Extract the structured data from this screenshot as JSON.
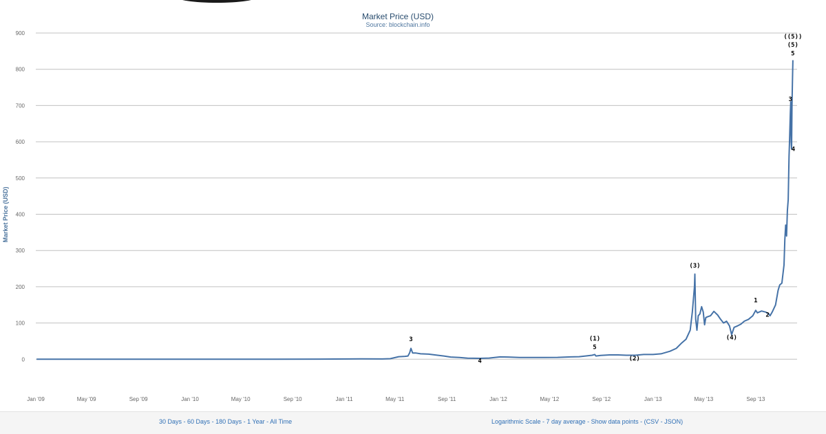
{
  "chart_data": {
    "type": "line",
    "title": "Market Price (USD)",
    "subtitle": "Source: blockchain.info",
    "ylabel": "Market Price (USD)",
    "xlabel": "",
    "xlim": [
      "2009-01-01",
      "2013-12-08"
    ],
    "ylim": [
      -100,
      900
    ],
    "yticks": [
      0,
      100,
      200,
      300,
      400,
      500,
      600,
      700,
      800,
      900
    ],
    "xticks": [
      {
        "date": "2009-01-01",
        "label": "Jan '09"
      },
      {
        "date": "2009-05-01",
        "label": "May '09"
      },
      {
        "date": "2009-09-01",
        "label": "Sep '09"
      },
      {
        "date": "2010-01-01",
        "label": "Jan '10"
      },
      {
        "date": "2010-05-01",
        "label": "May '10"
      },
      {
        "date": "2010-09-01",
        "label": "Sep '10"
      },
      {
        "date": "2011-01-01",
        "label": "Jan '11"
      },
      {
        "date": "2011-05-01",
        "label": "May '11"
      },
      {
        "date": "2011-09-01",
        "label": "Sep '11"
      },
      {
        "date": "2012-01-01",
        "label": "Jan '12"
      },
      {
        "date": "2012-05-01",
        "label": "May '12"
      },
      {
        "date": "2012-09-01",
        "label": "Sep '12"
      },
      {
        "date": "2013-01-01",
        "label": "Jan '13"
      },
      {
        "date": "2013-05-01",
        "label": "May '13"
      },
      {
        "date": "2013-09-01",
        "label": "Sep '13"
      }
    ],
    "grid": true,
    "line_color": "#4572a7",
    "series": [
      {
        "points": [
          [
            "2009-01-03",
            0
          ],
          [
            "2010-07-17",
            0.05
          ],
          [
            "2010-11-06",
            0.4
          ],
          [
            "2011-02-10",
            1
          ],
          [
            "2011-04-01",
            0.8
          ],
          [
            "2011-04-20",
            1.5
          ],
          [
            "2011-05-10",
            7
          ],
          [
            "2011-05-25",
            8
          ],
          [
            "2011-06-01",
            9
          ],
          [
            "2011-06-05",
            18
          ],
          [
            "2011-06-08",
            30
          ],
          [
            "2011-06-12",
            17
          ],
          [
            "2011-06-20",
            17
          ],
          [
            "2011-07-01",
            15
          ],
          [
            "2011-07-20",
            14
          ],
          [
            "2011-08-10",
            11
          ],
          [
            "2011-08-25",
            9
          ],
          [
            "2011-09-10",
            6
          ],
          [
            "2011-10-01",
            5
          ],
          [
            "2011-10-20",
            3
          ],
          [
            "2011-11-18",
            2.5
          ],
          [
            "2011-12-10",
            3.2
          ],
          [
            "2012-01-05",
            6.5
          ],
          [
            "2012-01-25",
            6
          ],
          [
            "2012-02-20",
            5
          ],
          [
            "2012-03-20",
            5
          ],
          [
            "2012-04-20",
            5
          ],
          [
            "2012-05-20",
            5.2
          ],
          [
            "2012-06-20",
            6.5
          ],
          [
            "2012-07-10",
            7
          ],
          [
            "2012-07-25",
            9
          ],
          [
            "2012-08-10",
            11
          ],
          [
            "2012-08-16",
            13
          ],
          [
            "2012-08-19",
            9
          ],
          [
            "2012-08-30",
            10.5
          ],
          [
            "2012-09-20",
            12
          ],
          [
            "2012-10-10",
            12
          ],
          [
            "2012-10-30",
            11
          ],
          [
            "2012-11-20",
            11
          ],
          [
            "2012-12-10",
            13
          ],
          [
            "2013-01-01",
            13
          ],
          [
            "2013-01-20",
            15
          ],
          [
            "2013-02-10",
            22
          ],
          [
            "2013-02-25",
            30
          ],
          [
            "2013-03-10",
            45
          ],
          [
            "2013-03-20",
            55
          ],
          [
            "2013-03-30",
            80
          ],
          [
            "2013-04-04",
            130
          ],
          [
            "2013-04-09",
            200
          ],
          [
            "2013-04-10",
            235
          ],
          [
            "2013-04-12",
            110
          ],
          [
            "2013-04-15",
            80
          ],
          [
            "2013-04-18",
            120
          ],
          [
            "2013-04-22",
            125
          ],
          [
            "2013-04-26",
            145
          ],
          [
            "2013-04-30",
            130
          ],
          [
            "2013-05-03",
            95
          ],
          [
            "2013-05-06",
            115
          ],
          [
            "2013-05-10",
            117
          ],
          [
            "2013-05-17",
            120
          ],
          [
            "2013-05-25",
            132
          ],
          [
            "2013-06-03",
            122
          ],
          [
            "2013-06-10",
            110
          ],
          [
            "2013-06-17",
            100
          ],
          [
            "2013-06-24",
            105
          ],
          [
            "2013-07-01",
            92
          ],
          [
            "2013-07-06",
            68
          ],
          [
            "2013-07-12",
            88
          ],
          [
            "2013-07-20",
            92
          ],
          [
            "2013-07-28",
            97
          ],
          [
            "2013-08-05",
            105
          ],
          [
            "2013-08-15",
            110
          ],
          [
            "2013-08-25",
            120
          ],
          [
            "2013-09-01",
            135
          ],
          [
            "2013-09-05",
            128
          ],
          [
            "2013-09-15",
            133
          ],
          [
            "2013-09-25",
            130
          ],
          [
            "2013-10-02",
            125
          ],
          [
            "2013-10-05",
            120
          ],
          [
            "2013-10-10",
            130
          ],
          [
            "2013-10-18",
            150
          ],
          [
            "2013-10-24",
            190
          ],
          [
            "2013-10-28",
            205
          ],
          [
            "2013-11-02",
            210
          ],
          [
            "2013-11-07",
            260
          ],
          [
            "2013-11-09",
            330
          ],
          [
            "2013-11-11",
            370
          ],
          [
            "2013-11-13",
            340
          ],
          [
            "2013-11-15",
            410
          ],
          [
            "2013-11-17",
            440
          ],
          [
            "2013-11-18",
            500
          ],
          [
            "2013-11-19",
            560
          ],
          [
            "2013-11-20",
            600
          ],
          [
            "2013-11-22",
            680
          ],
          [
            "2013-11-23",
            710
          ],
          [
            "2013-11-24",
            600
          ],
          [
            "2013-11-25",
            580
          ],
          [
            "2013-11-26",
            700
          ],
          [
            "2013-11-27",
            760
          ],
          [
            "2013-11-28",
            825
          ]
        ]
      }
    ],
    "annotations": [
      {
        "text": "3",
        "date": "2011-06-08",
        "value": 50
      },
      {
        "text": "4",
        "date": "2011-11-18",
        "value": -10
      },
      {
        "text": "(1)",
        "date": "2012-08-16",
        "value": 52
      },
      {
        "text": "5",
        "date": "2012-08-16",
        "value": 28
      },
      {
        "text": "(2)",
        "date": "2012-11-18",
        "value": -3
      },
      {
        "text": "(3)",
        "date": "2013-04-10",
        "value": 253
      },
      {
        "text": "(4)",
        "date": "2013-07-06",
        "value": 55
      },
      {
        "text": "1",
        "date": "2013-09-01",
        "value": 157
      },
      {
        "text": "2",
        "date": "2013-09-29",
        "value": 117
      },
      {
        "text": "3",
        "date": "2013-11-22",
        "value": 712
      },
      {
        "text": "4",
        "date": "2013-11-29",
        "value": 575
      },
      {
        "text": "5",
        "date": "2013-11-28",
        "value": 838
      },
      {
        "text": "(5)",
        "date": "2013-11-28",
        "value": 862
      },
      {
        "text": "((5))",
        "date": "2013-11-28",
        "value": 885
      }
    ]
  },
  "footer": {
    "range_links": [
      "30 Days",
      "60 Days",
      "180 Days",
      "1 Year",
      "All Time"
    ],
    "option_links": [
      "Logarithmic Scale",
      "7 day average",
      "Show data points"
    ],
    "export_prefix": "(",
    "export_links": [
      "CSV",
      "JSON"
    ],
    "export_suffix": ")",
    "separator": " - "
  }
}
